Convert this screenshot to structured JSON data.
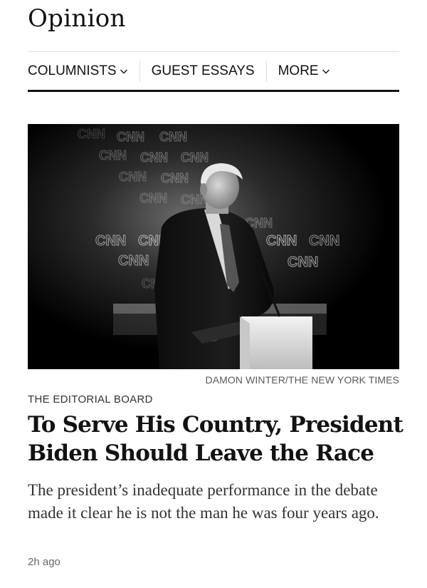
{
  "section": {
    "title": "Opinion"
  },
  "nav": {
    "items": [
      {
        "label": "COLUMNISTS",
        "icon": "chevron-down-icon"
      },
      {
        "label": "GUEST ESSAYS"
      },
      {
        "label": "MORE",
        "icon": "chevron-down-icon"
      }
    ]
  },
  "article": {
    "photo_credit": "DAMON WINTER/THE NEW YORK TIMES",
    "kicker": "THE EDITORIAL BOARD",
    "headline": "To Serve His Country, President Biden Should Leave the Race",
    "summary": "The president’s inadequate performance in the debate made it clear he is not the man he was four years ago.",
    "timestamp": "2h ago",
    "photo_logo_text": "CNN"
  },
  "colors": {
    "text": "#121212",
    "rule": "#dfdfdf",
    "muted": "#666666"
  }
}
